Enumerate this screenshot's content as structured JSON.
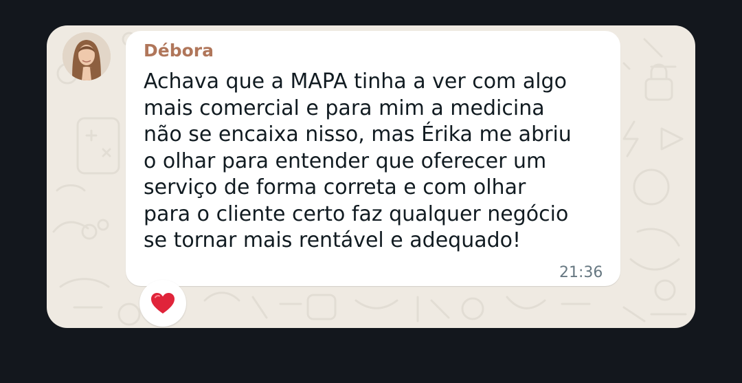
{
  "chat": {
    "sender_name": "Débora",
    "message_lines": [
      "Achava que a MAPA tinha a ver com algo",
      "mais comercial e para mim a medicina",
      "não se encaixa nisso, mas Érika me abriu",
      "o olhar para entender que oferecer um",
      "serviço de forma correta e com olhar",
      "para o cliente certo faz qualquer negócio",
      "se tornar mais rentável e adequado!"
    ],
    "time": "21:36",
    "reaction": "❤"
  },
  "colors": {
    "page_background": "#13171d",
    "chat_wallpaper": "#efeae2",
    "bubble": "#ffffff",
    "sender_name": "#b0765a",
    "message_text": "#111b21",
    "timestamp": "#667781",
    "reaction_heart": "#e0243a"
  },
  "icons": {
    "avatar": "contact-avatar-photo",
    "reaction": "red-heart-icon"
  }
}
